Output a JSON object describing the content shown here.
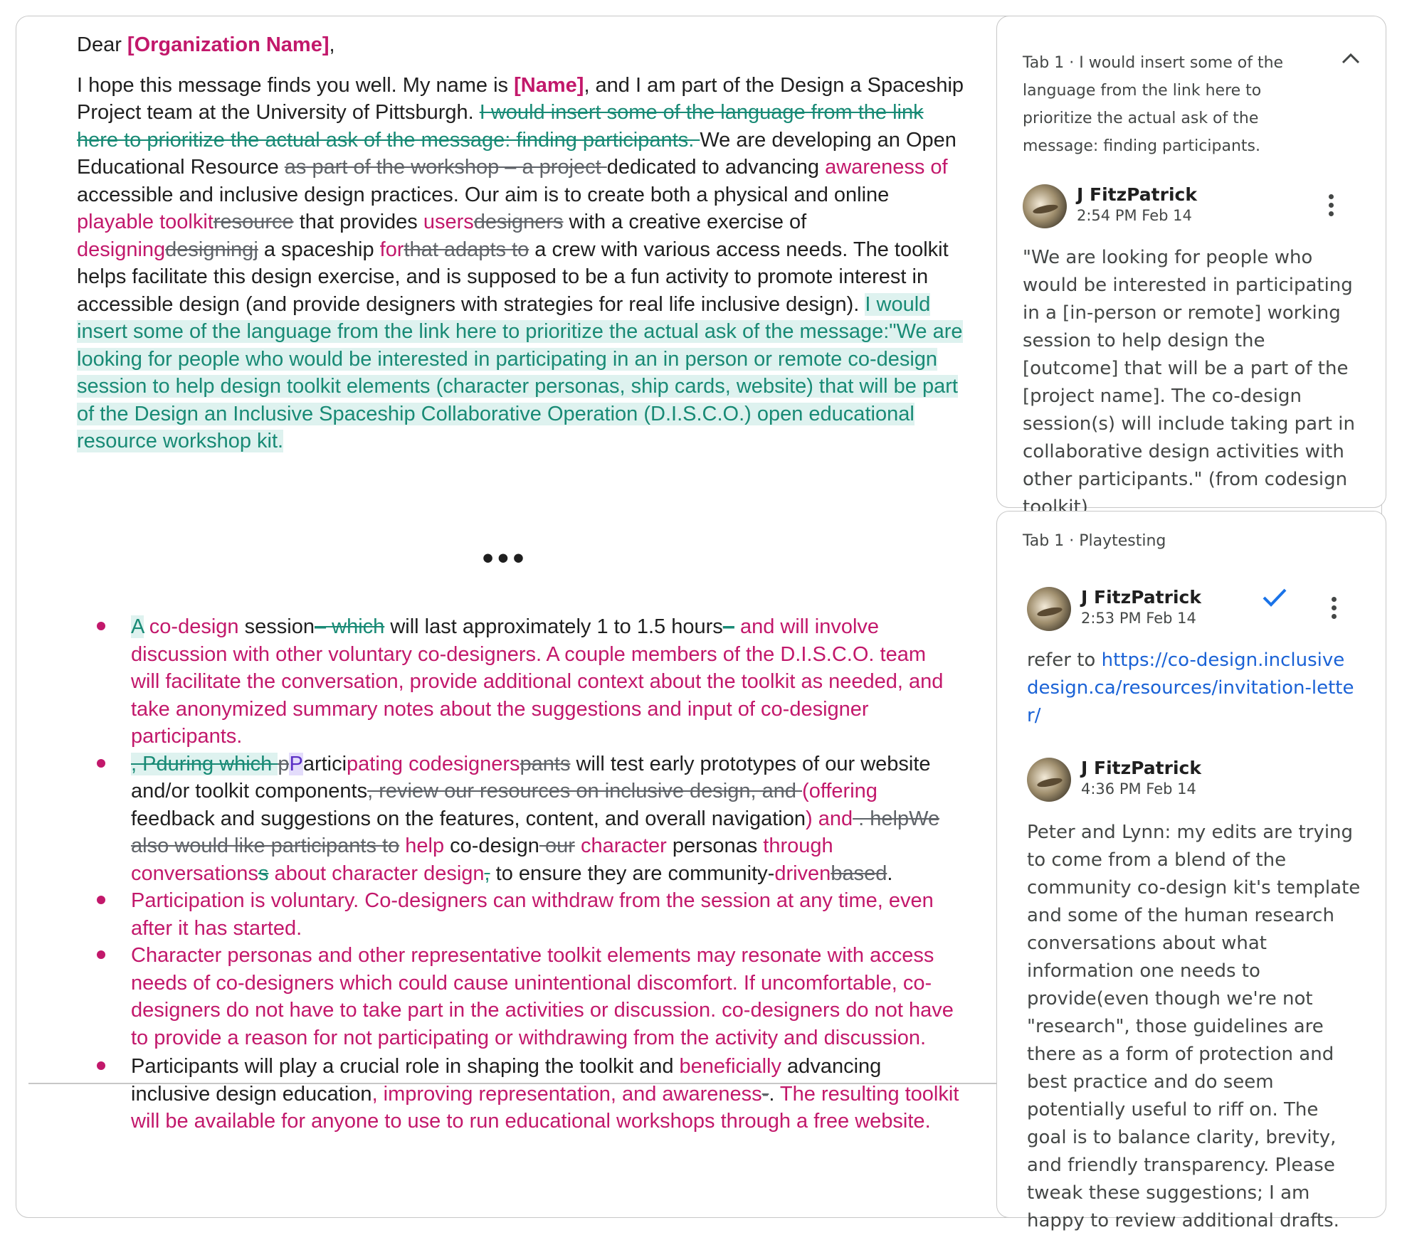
{
  "document": {
    "greeting": {
      "dear": "Dear ",
      "org": "[Organization Name]",
      "comma": ","
    },
    "intro": {
      "t1": "I hope this message finds you well. My name is ",
      "name": "[Name]",
      "t2": ", and I am part of the Design a Spaceship Project team at the University of Pittsburgh. ",
      "del1": "I would insert some of the language from the link here to prioritize the actual ask of the message: finding participants. ",
      "t3": "We are developing an Open Educational Resource ",
      "del2": "as part of the workshop – a project ",
      "t4": "dedicated to advancing ",
      "ins1": "awareness of",
      "t5": " accessible and inclusive design practices. Our aim is to create both a physical and online ",
      "ins2": "playable toolkit",
      "del3": "resource",
      "t6": " that provides ",
      "ins3": "users",
      "del4": "designers",
      "t7": " with a creative exercise of ",
      "ins4": "designing",
      "del5": "designingj",
      "t8": " a spaceship ",
      "ins5": "for",
      "del6": "that adapts to",
      "t9": " a crew with various access needs. The toolkit helps facilitate this design exercise, and is supposed to be a fun activity to promote interest in accessible design (and provide designers with strategies for real life inclusive design). ",
      "hl": "I would insert some of the language from the link here to prioritize the actual ask of the message:\"We are looking for people who would be interested in participating in an in person or remote co-design session to help design toolkit elements (character personas, ship cards, website) that will be part of the Design an Inclusive Spaceship Collaborative Operation (D.I.S.C.O.) open educational resource workshop kit. "
    },
    "ellipsis": "•••",
    "b1": {
      "a": "A",
      "b": " co-design",
      "c": " session",
      "d": "– which",
      "e": " will last approximately 1 to 1.5 hours",
      "f": "–",
      "g": " and will involve discussion with other voluntary co-designers. A couple members of the D.I.S.C.O. team will facilitate the conversation, provide additional context about the toolkit as needed, and take anonymized summary notes about the suggestions and input of co-designer participants."
    },
    "b2": {
      "a": ", Pduring which ",
      "b": "p",
      "c": "P",
      "d": "artici",
      "e": "pating codesigners",
      "f": "pants",
      "g": " will test early prototypes of our website and/or toolkit components",
      "h": ", review our resources on inclusive design, and ",
      "i": " (offer",
      "j": "ing",
      "k": " feedback and suggestions on the features, content, and overall navigation",
      "l": ") and",
      "m": " . help",
      "n": "We also would like participants to",
      "o": " help",
      "p": " co-design",
      "q": " our",
      "r": " character",
      "s": " personas ",
      "t": "through conversations",
      "u": "s",
      "v": " about character design",
      "w": ",",
      "x": " to ensure they are community-",
      "y": "driven",
      "z": "based",
      "end": "."
    },
    "b3": "Participation is voluntary. Co-designers can withdraw from the session at any time, even after it has started.",
    "b4": "Character personas and other representative toolkit elements may resonate with access needs of co-designers which could cause unintentional discomfort. If uncomfortable, co-designers do not have to take part in the activities or discussion. co-designers do not have to provide a reason for not participating or withdrawing from the activity and discussion.",
    "b5": {
      "a": "Participants will play a crucial role in shaping the toolkit and ",
      "b": "beneficially",
      "c": " advancing inclusive design education",
      "d": ", improving representation, and awareness",
      "e": "-",
      "f": ".",
      "g": " The resulting toolkit will be available for anyone to use to run educational workshops through a free website."
    }
  },
  "comments": [
    {
      "header": "Tab 1 · I would insert some of the language from the link here to prioritize the actual ask of the message: finding participants.",
      "author": "J FitzPatrick",
      "time": "2:54 PM Feb 14",
      "text": "\"We are looking for people who would be interested in participating in a [in-person or remote] working session to help design the [outcome] that will be a part of the [project name]. The co-design session(s) will include taking part in collaborative design activities with other participants.\" (from codesign toolkit)"
    },
    {
      "header": "Tab 1 · Playtesting",
      "author": "J FitzPatrick",
      "time": "2:53 PM Feb 14",
      "text_prefix": "refer to ",
      "link": "https://co-design.inclusivedesign.ca/resources/invitation-letter/",
      "reply_author": "J FitzPatrick",
      "reply_time": "4:36 PM Feb 14",
      "reply_text": "Peter and Lynn: my edits are trying to come from a blend of the community co-design kit's template and some of the human research conversations about what information one needs to provide(even though we're not \"research\", those guidelines are there as a form of protection and best practice and do seem potentially useful to riff on.  The goal is to balance clarity, brevity, and friendly transparency. Please tweak these suggestions; I am happy to review additional drafts."
    }
  ],
  "colors": {
    "insert": "#c2186b",
    "delete": "#5f6368",
    "highlight": "#def2ef",
    "link": "#1a62d6"
  },
  "icons": [
    "chevron-up-icon",
    "more-vert-icon",
    "check-icon"
  ]
}
